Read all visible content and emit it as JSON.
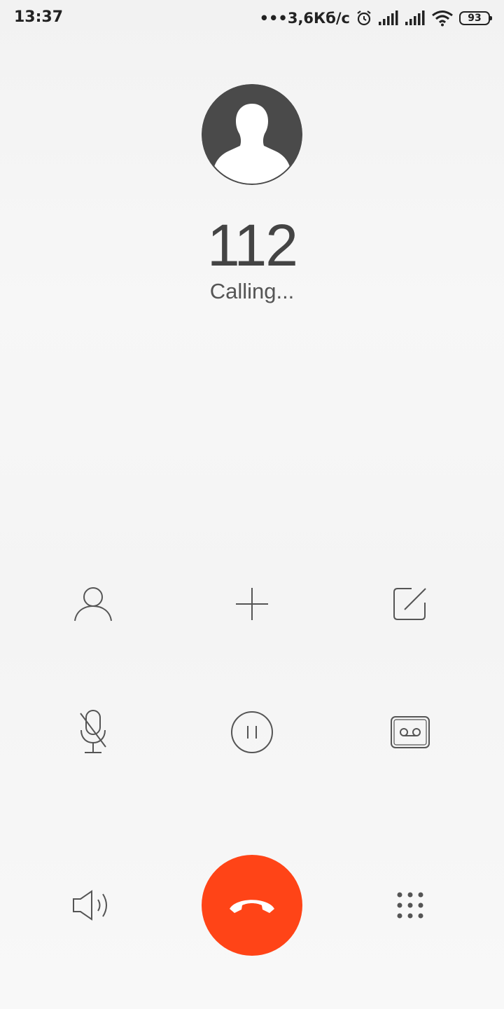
{
  "status_bar": {
    "time": "13:37",
    "network_speed": "•••3,6Кб/с",
    "battery_level": "93",
    "icons": [
      "alarm-icon",
      "signal-icon",
      "signal-icon",
      "wifi-icon",
      "battery-icon"
    ]
  },
  "call": {
    "number": "112",
    "status": "Calling..."
  },
  "controls": [
    {
      "icon": "contacts-icon"
    },
    {
      "icon": "add-call-icon"
    },
    {
      "icon": "note-icon"
    },
    {
      "icon": "mute-icon"
    },
    {
      "icon": "hold-icon"
    },
    {
      "icon": "record-icon"
    },
    {
      "icon": "speaker-icon"
    },
    {
      "icon": "end-call-icon"
    },
    {
      "icon": "dialpad-icon"
    }
  ],
  "colors": {
    "end_call": "#ff4417",
    "avatar": "#4a4a4a",
    "icon_stroke": "#555555"
  }
}
